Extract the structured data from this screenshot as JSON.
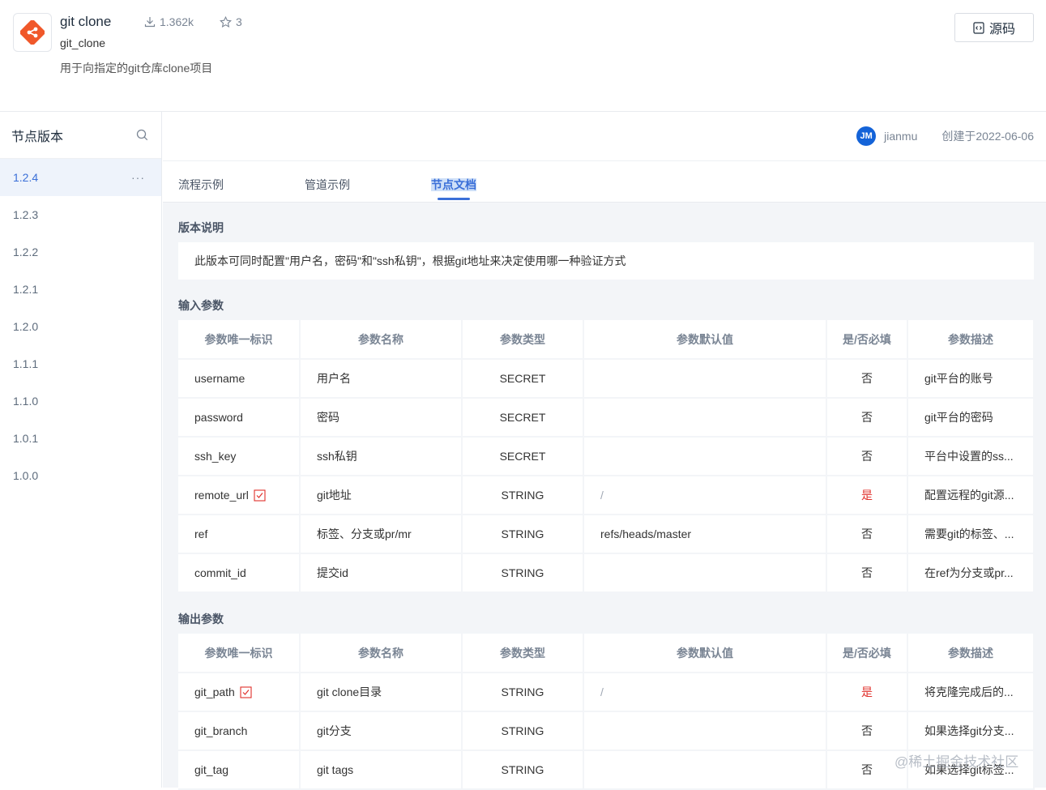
{
  "header": {
    "title": "git clone",
    "subname": "git_clone",
    "description": "用于向指定的git仓库clone项目",
    "downloads": "1.362k",
    "stars": "3",
    "source_button": "源码"
  },
  "sidebar": {
    "title": "节点版本",
    "versions": [
      "1.2.4",
      "1.2.3",
      "1.2.2",
      "1.2.1",
      "1.2.0",
      "1.1.1",
      "1.1.0",
      "1.0.1",
      "1.0.0"
    ],
    "more": "···"
  },
  "author": {
    "avatar_text": "JM",
    "name": "jianmu",
    "created": "创建于2022-06-06"
  },
  "tabs": [
    "流程示例",
    "管道示例",
    "节点文档"
  ],
  "doc": {
    "version_title": "版本说明",
    "version_desc": "此版本可同时配置\"用户名，密码\"和\"ssh私钥\"，根据git地址来决定使用哪一种验证方式",
    "input_title": "输入参数",
    "output_title": "输出参数",
    "columns": [
      "参数唯一标识",
      "参数名称",
      "参数类型",
      "参数默认值",
      "是/否必填",
      "参数描述"
    ],
    "inputs": [
      {
        "id": "username",
        "name": "用户名",
        "type": "SECRET",
        "default": "",
        "required": "否",
        "desc": "git平台的账号"
      },
      {
        "id": "password",
        "name": "密码",
        "type": "SECRET",
        "default": "",
        "required": "否",
        "desc": "git平台的密码"
      },
      {
        "id": "ssh_key",
        "name": "ssh私钥",
        "type": "SECRET",
        "default": "",
        "required": "否",
        "desc": "平台中设置的ss..."
      },
      {
        "id": "remote_url",
        "name": "git地址",
        "type": "STRING",
        "default": "/",
        "required": "是",
        "desc": "配置远程的git源..."
      },
      {
        "id": "ref",
        "name": "标签、分支或pr/mr",
        "type": "STRING",
        "default": "refs/heads/master",
        "required": "否",
        "desc": "需要git的标签、..."
      },
      {
        "id": "commit_id",
        "name": "提交id",
        "type": "STRING",
        "default": "",
        "required": "否",
        "desc": "在ref为分支或pr..."
      }
    ],
    "outputs": [
      {
        "id": "git_path",
        "name": "git clone目录",
        "type": "STRING",
        "default": "/",
        "required": "是",
        "desc": "将克隆完成后的..."
      },
      {
        "id": "git_branch",
        "name": "git分支",
        "type": "STRING",
        "default": "",
        "required": "否",
        "desc": "如果选择git分支..."
      },
      {
        "id": "git_tag",
        "name": "git tags",
        "type": "STRING",
        "default": "",
        "required": "否",
        "desc": "如果选择git标签..."
      }
    ]
  },
  "watermark": "@稀土掘金技术社区",
  "colors": {
    "accent": "#3a6fd8",
    "required": "#e0302b",
    "logo": "#f0582a"
  }
}
